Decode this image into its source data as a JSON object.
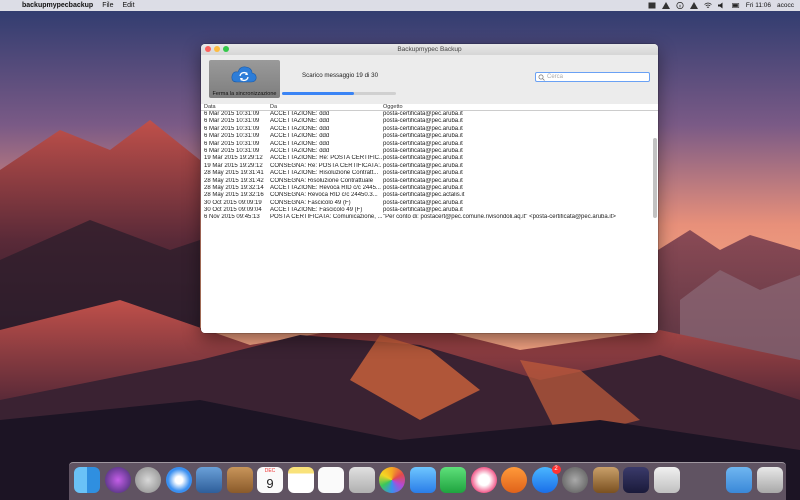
{
  "menubar": {
    "app_name": "backupmypecbackup",
    "menus": [
      "File",
      "Edit"
    ],
    "clock": "Fri 11:06",
    "user": "acocc"
  },
  "window": {
    "title": "Backupmypec Backup",
    "sync_button_label": "Ferma la sincronizzazione",
    "progress_text": "Scarico messaggio 19 di 30",
    "progress_fraction": 0.63,
    "search_placeholder": "Cerca",
    "columns": [
      "Data",
      "Da",
      "Oggetto"
    ],
    "rows": [
      [
        "6 Mar 2015 10:31:09",
        "ACCETTAZIONE: ddd",
        "posta-certificata@pec.aruba.it"
      ],
      [
        "6 Mar 2015 10:31:09",
        "ACCETTAZIONE: ddd",
        "posta-certificata@pec.aruba.it"
      ],
      [
        "6 Mar 2015 10:31:09",
        "ACCETTAZIONE: ddd",
        "posta-certificata@pec.aruba.it"
      ],
      [
        "6 Mar 2015 10:31:09",
        "ACCETTAZIONE: ddd",
        "posta-certificata@pec.aruba.it"
      ],
      [
        "6 Mar 2015 10:31:09",
        "ACCETTAZIONE: ddd",
        "posta-certificata@pec.aruba.it"
      ],
      [
        "6 Mar 2015 10:31:09",
        "ACCETTAZIONE: ddd",
        "posta-certificata@pec.aruba.it"
      ],
      [
        "19 Mar 2015 19:29:12",
        "ACCETTAZIONE: Re: POSTA CERTIFIC...",
        "posta-certificata@pec.aruba.it"
      ],
      [
        "19 Mar 2015 19:29:12",
        "CONSEGNA: Re: POSTA CERTIFICATA:...",
        "posta-certificata@pec.aruba.it"
      ],
      [
        "28 May 2015 19:31:41",
        "ACCETTAZIONE: Risoluzione Contratt...",
        "posta-certificata@pec.aruba.it"
      ],
      [
        "28 May 2015 19:31:42",
        "CONSEGNA: Risoluzione Contrattuale",
        "posta-certificata@pec.aruba.it"
      ],
      [
        "28 May 2015 19:32:14",
        "ACCETTAZIONE: Revoca RID c/c 2445...",
        "posta-certificata@pec.aruba.it"
      ],
      [
        "28 May 2015 19:32:16",
        "CONSEGNA: Revoca RID c/c 24450.3...",
        "posta-certificata@pec.actalis.it"
      ],
      [
        "30 Oct 2015 09:09:19",
        "CONSEGNA: Fascicolo 49 (F)",
        "posta-certificata@pec.aruba.it"
      ],
      [
        "30 Oct 2015 09:09:04",
        "ACCETTAZIONE: Fascicolo 49 (F)",
        "posta-certificata@pec.aruba.it"
      ],
      [
        "6 Nov 2015 09:45:13",
        "POSTA CERTIFICATA: Comunicazione, ...",
        "\"Per conto di: postacert@pec.comune.rivisondoli.aq.it\" <posta-certificata@pec.aruba.it>"
      ]
    ]
  },
  "dock": {
    "calendar_month": "DEC",
    "calendar_day": "9",
    "app_store_badge": "2",
    "icons": [
      "finder-icon",
      "siri-icon",
      "launchpad-icon",
      "safari-icon",
      "mail-photo-icon",
      "contacts-icon",
      "calendar-icon",
      "notes-icon",
      "reminders-icon",
      "preview-icon",
      "photos-icon",
      "messages-icon",
      "facetime-icon",
      "itunes-icon",
      "ibooks-icon",
      "app-store-icon",
      "system-preferences-icon",
      "keynote-icon",
      "pen-app-icon",
      "charts-app-icon",
      "folder-icon",
      "trash-icon"
    ]
  }
}
